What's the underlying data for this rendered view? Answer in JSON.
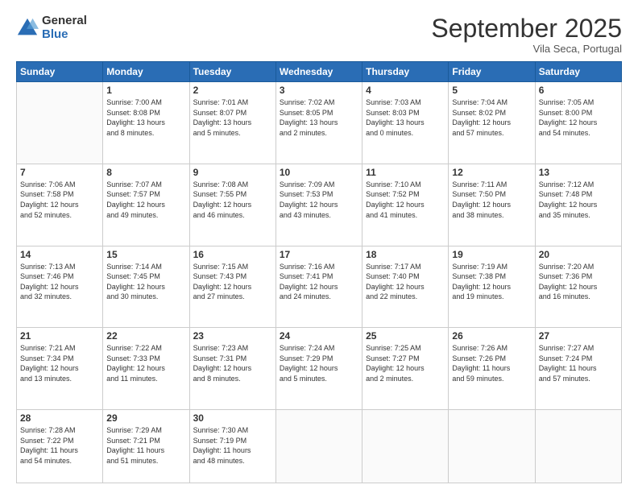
{
  "logo": {
    "general": "General",
    "blue": "Blue"
  },
  "title": "September 2025",
  "location": "Vila Seca, Portugal",
  "days_header": [
    "Sunday",
    "Monday",
    "Tuesday",
    "Wednesday",
    "Thursday",
    "Friday",
    "Saturday"
  ],
  "weeks": [
    [
      {
        "num": "",
        "info": ""
      },
      {
        "num": "1",
        "info": "Sunrise: 7:00 AM\nSunset: 8:08 PM\nDaylight: 13 hours\nand 8 minutes."
      },
      {
        "num": "2",
        "info": "Sunrise: 7:01 AM\nSunset: 8:07 PM\nDaylight: 13 hours\nand 5 minutes."
      },
      {
        "num": "3",
        "info": "Sunrise: 7:02 AM\nSunset: 8:05 PM\nDaylight: 13 hours\nand 2 minutes."
      },
      {
        "num": "4",
        "info": "Sunrise: 7:03 AM\nSunset: 8:03 PM\nDaylight: 13 hours\nand 0 minutes."
      },
      {
        "num": "5",
        "info": "Sunrise: 7:04 AM\nSunset: 8:02 PM\nDaylight: 12 hours\nand 57 minutes."
      },
      {
        "num": "6",
        "info": "Sunrise: 7:05 AM\nSunset: 8:00 PM\nDaylight: 12 hours\nand 54 minutes."
      }
    ],
    [
      {
        "num": "7",
        "info": "Sunrise: 7:06 AM\nSunset: 7:58 PM\nDaylight: 12 hours\nand 52 minutes."
      },
      {
        "num": "8",
        "info": "Sunrise: 7:07 AM\nSunset: 7:57 PM\nDaylight: 12 hours\nand 49 minutes."
      },
      {
        "num": "9",
        "info": "Sunrise: 7:08 AM\nSunset: 7:55 PM\nDaylight: 12 hours\nand 46 minutes."
      },
      {
        "num": "10",
        "info": "Sunrise: 7:09 AM\nSunset: 7:53 PM\nDaylight: 12 hours\nand 43 minutes."
      },
      {
        "num": "11",
        "info": "Sunrise: 7:10 AM\nSunset: 7:52 PM\nDaylight: 12 hours\nand 41 minutes."
      },
      {
        "num": "12",
        "info": "Sunrise: 7:11 AM\nSunset: 7:50 PM\nDaylight: 12 hours\nand 38 minutes."
      },
      {
        "num": "13",
        "info": "Sunrise: 7:12 AM\nSunset: 7:48 PM\nDaylight: 12 hours\nand 35 minutes."
      }
    ],
    [
      {
        "num": "14",
        "info": "Sunrise: 7:13 AM\nSunset: 7:46 PM\nDaylight: 12 hours\nand 32 minutes."
      },
      {
        "num": "15",
        "info": "Sunrise: 7:14 AM\nSunset: 7:45 PM\nDaylight: 12 hours\nand 30 minutes."
      },
      {
        "num": "16",
        "info": "Sunrise: 7:15 AM\nSunset: 7:43 PM\nDaylight: 12 hours\nand 27 minutes."
      },
      {
        "num": "17",
        "info": "Sunrise: 7:16 AM\nSunset: 7:41 PM\nDaylight: 12 hours\nand 24 minutes."
      },
      {
        "num": "18",
        "info": "Sunrise: 7:17 AM\nSunset: 7:40 PM\nDaylight: 12 hours\nand 22 minutes."
      },
      {
        "num": "19",
        "info": "Sunrise: 7:19 AM\nSunset: 7:38 PM\nDaylight: 12 hours\nand 19 minutes."
      },
      {
        "num": "20",
        "info": "Sunrise: 7:20 AM\nSunset: 7:36 PM\nDaylight: 12 hours\nand 16 minutes."
      }
    ],
    [
      {
        "num": "21",
        "info": "Sunrise: 7:21 AM\nSunset: 7:34 PM\nDaylight: 12 hours\nand 13 minutes."
      },
      {
        "num": "22",
        "info": "Sunrise: 7:22 AM\nSunset: 7:33 PM\nDaylight: 12 hours\nand 11 minutes."
      },
      {
        "num": "23",
        "info": "Sunrise: 7:23 AM\nSunset: 7:31 PM\nDaylight: 12 hours\nand 8 minutes."
      },
      {
        "num": "24",
        "info": "Sunrise: 7:24 AM\nSunset: 7:29 PM\nDaylight: 12 hours\nand 5 minutes."
      },
      {
        "num": "25",
        "info": "Sunrise: 7:25 AM\nSunset: 7:27 PM\nDaylight: 12 hours\nand 2 minutes."
      },
      {
        "num": "26",
        "info": "Sunrise: 7:26 AM\nSunset: 7:26 PM\nDaylight: 11 hours\nand 59 minutes."
      },
      {
        "num": "27",
        "info": "Sunrise: 7:27 AM\nSunset: 7:24 PM\nDaylight: 11 hours\nand 57 minutes."
      }
    ],
    [
      {
        "num": "28",
        "info": "Sunrise: 7:28 AM\nSunset: 7:22 PM\nDaylight: 11 hours\nand 54 minutes."
      },
      {
        "num": "29",
        "info": "Sunrise: 7:29 AM\nSunset: 7:21 PM\nDaylight: 11 hours\nand 51 minutes."
      },
      {
        "num": "30",
        "info": "Sunrise: 7:30 AM\nSunset: 7:19 PM\nDaylight: 11 hours\nand 48 minutes."
      },
      {
        "num": "",
        "info": ""
      },
      {
        "num": "",
        "info": ""
      },
      {
        "num": "",
        "info": ""
      },
      {
        "num": "",
        "info": ""
      }
    ]
  ]
}
